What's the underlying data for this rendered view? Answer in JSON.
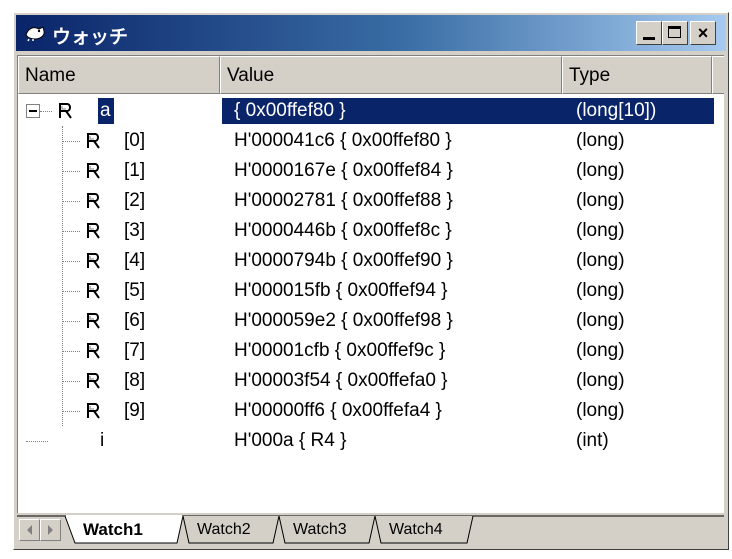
{
  "window": {
    "title": "ウォッチ"
  },
  "columns": {
    "name": "Name",
    "value": "Value",
    "type": "Type"
  },
  "rows": [
    {
      "name": "a",
      "value": "{ 0x00ffef80 }",
      "type": "(long[10])",
      "selected": true
    },
    {
      "name": "[0]",
      "value": "H'000041c6 { 0x00ffef80 }",
      "type": "(long)"
    },
    {
      "name": "[1]",
      "value": "H'0000167e { 0x00ffef84 }",
      "type": "(long)"
    },
    {
      "name": "[2]",
      "value": "H'00002781 { 0x00ffef88 }",
      "type": "(long)"
    },
    {
      "name": "[3]",
      "value": "H'0000446b { 0x00ffef8c }",
      "type": "(long)"
    },
    {
      "name": "[4]",
      "value": "H'0000794b { 0x00ffef90 }",
      "type": "(long)"
    },
    {
      "name": "[5]",
      "value": "H'000015fb { 0x00ffef94 }",
      "type": "(long)"
    },
    {
      "name": "[6]",
      "value": "H'000059e2 { 0x00ffef98 }",
      "type": "(long)"
    },
    {
      "name": "[7]",
      "value": "H'00001cfb { 0x00ffef9c }",
      "type": "(long)"
    },
    {
      "name": "[8]",
      "value": "H'00003f54 { 0x00ffefa0 }",
      "type": "(long)"
    },
    {
      "name": "[9]",
      "value": "H'00000ff6 { 0x00ffefa4 }",
      "type": "(long)"
    },
    {
      "name": "i",
      "value": "H'000a { R4 }",
      "type": "(int)"
    }
  ],
  "tabs": [
    {
      "label": "Watch1",
      "active": true
    },
    {
      "label": "Watch2"
    },
    {
      "label": "Watch3"
    },
    {
      "label": "Watch4"
    }
  ],
  "icons": {
    "app": "watch-window-icon",
    "register": "register-r-icon",
    "collapse": "tree-collapse-icon",
    "scroll_left": "scroll-left-arrow-icon",
    "scroll_right": "scroll-right-arrow-icon"
  },
  "colors": {
    "titlebar_start": "#0a246a",
    "titlebar_end": "#a6caf0",
    "selection": "#0a246a",
    "face": "#d4d0c8"
  }
}
